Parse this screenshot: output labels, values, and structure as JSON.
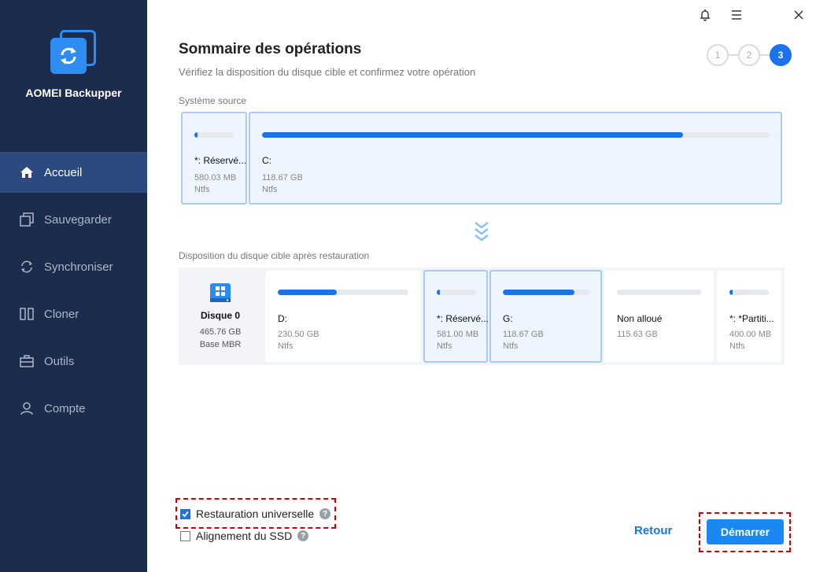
{
  "app": {
    "name": "AOMEI Backupper"
  },
  "sidebar": {
    "items": [
      {
        "label": "Accueil",
        "icon": "home-icon",
        "active": true
      },
      {
        "label": "Sauvegarder",
        "icon": "backup-icon"
      },
      {
        "label": "Synchroniser",
        "icon": "sync-icon"
      },
      {
        "label": "Cloner",
        "icon": "clone-icon"
      },
      {
        "label": "Outils",
        "icon": "toolbox-icon"
      },
      {
        "label": "Compte",
        "icon": "user-icon"
      }
    ]
  },
  "titlebar": {
    "icons": [
      "bell-icon",
      "menu-icon",
      "close-icon"
    ]
  },
  "header": {
    "title": "Sommaire des opérations",
    "subtitle": "Vérifiez la disposition du disque cible et confirmez votre opération"
  },
  "steps": {
    "items": [
      "1",
      "2",
      "3"
    ],
    "current": 3
  },
  "source": {
    "label": "Système source",
    "partitions": [
      {
        "name": "*: Réservé...",
        "size": "580.03 MB",
        "fs": "Ntfs",
        "fill": 0.02
      },
      {
        "name": "C:",
        "size": "118.67 GB",
        "fs": "Ntfs",
        "fill": 0.83
      }
    ]
  },
  "target": {
    "label": "Disposition du disque cible après restauration",
    "disk": {
      "name": "Disque 0",
      "capacity": "465.76 GB",
      "type": "Base MBR"
    },
    "partitions": [
      {
        "name": "D:",
        "size": "230.50 GB",
        "fs": "Ntfs",
        "fill": 0.45
      },
      {
        "name": "*: Réservé...",
        "size": "581.00 MB",
        "fs": "Ntfs",
        "fill": 0.02
      },
      {
        "name": "G:",
        "size": "118.67 GB",
        "fs": "Ntfs",
        "fill": 0.83
      },
      {
        "name": "Non alloué",
        "size": "115.63 GB",
        "fs": "",
        "fill": 0
      },
      {
        "name": "*: *Partiti...",
        "size": "400.00 MB",
        "fs": "Ntfs",
        "fill": 0.02
      }
    ]
  },
  "options": {
    "universal_restore": {
      "label": "Restauration universelle",
      "checked": true
    },
    "ssd_align": {
      "label": "Alignement du SSD",
      "checked": false
    },
    "help_glyph": "?"
  },
  "buttons": {
    "back": "Retour",
    "start": "Démarrer"
  },
  "colors": {
    "sidebar": "#1c2c4c",
    "accent": "#1a73e8",
    "highlight": "#cc0000"
  }
}
